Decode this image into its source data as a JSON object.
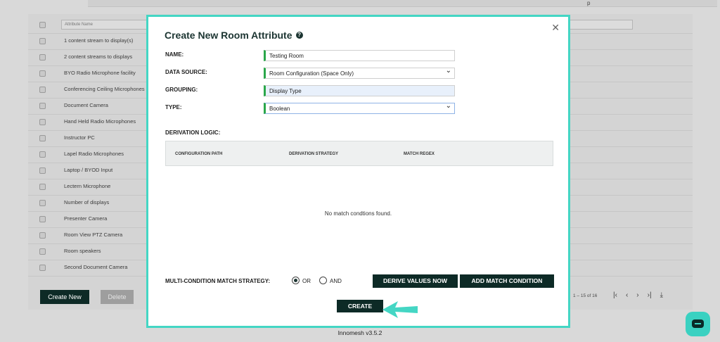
{
  "background": {
    "filter_placeholder": "Attribute Name",
    "rows": [
      "1 content stream to display(s)",
      "2 content streams to displays",
      "BYO Radio Microphone facility",
      "Conferencing Ceiling Microphones",
      "Document Camera",
      "Hand Held Radio Microphones",
      "Instructor PC",
      "Lapel Radio Microphones",
      "Laptop / BYOD Input",
      "Lectern Microphone",
      "Number of displays",
      "Presenter Camera",
      "Room View PTZ Camera",
      "Room speakers",
      "Second Document Camera"
    ],
    "create_new_label": "Create New",
    "delete_label": "Delete",
    "pager_text": "1 – 15 of 16",
    "pager_icons": [
      "first-page-icon",
      "prev-page-icon",
      "next-page-icon",
      "last-page-icon",
      "download-icon"
    ],
    "footer": "Innomesh v3.5.2",
    "corner_glyph": "p"
  },
  "modal": {
    "title": "Create New Room Attribute",
    "help_glyph": "?",
    "close_glyph": "✕",
    "fields": {
      "name_label": "NAME:",
      "name_value": "Testing Room",
      "data_source_label": "DATA SOURCE:",
      "data_source_value": "Room Configuration (Space Only)",
      "grouping_label": "GROUPING:",
      "grouping_value": "Display Type",
      "type_label": "TYPE:",
      "type_value": "Boolean"
    },
    "derivation": {
      "label": "DERIVATION LOGIC:",
      "columns": [
        "CONFIGURATION PATH",
        "DERIVATION STRATEGY",
        "MATCH REGEX"
      ],
      "empty_text": "No match condtions found."
    },
    "match_strategy": {
      "label": "MULTI-CONDITION MATCH STRATEGY:",
      "options": [
        "OR",
        "AND"
      ],
      "selected": "OR"
    },
    "derive_button": "DERIVE VALUES NOW",
    "add_condition_button": "ADD MATCH CONDITION",
    "create_button": "CREATE"
  },
  "colors": {
    "accent": "#44d6c4",
    "dark_button": "#0d2a26",
    "field_marker": "#2aa74a"
  }
}
